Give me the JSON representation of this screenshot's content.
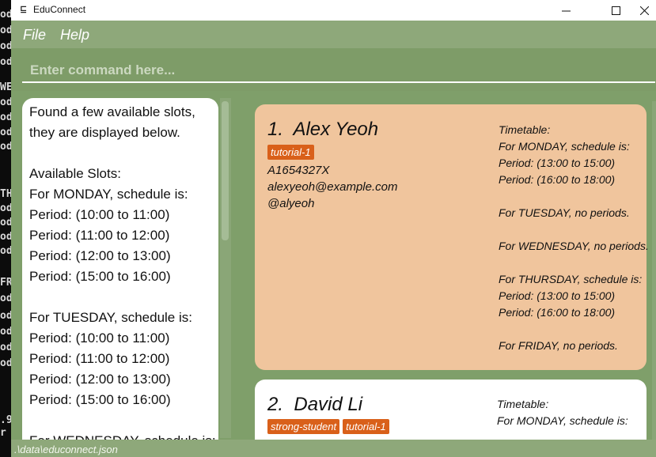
{
  "background_terminal": {
    "lines": [
      "od",
      "od",
      "od",
      "od",
      "WE",
      "od",
      "od",
      "od",
      "od",
      "TH",
      "od",
      "od",
      "od",
      "od",
      "FR",
      "od",
      "od",
      "od",
      "od",
      "od",
      "",
      ".9",
      "r"
    ]
  },
  "window": {
    "title": "EduConnect",
    "controls": {
      "minimize": "—",
      "maximize": "☐",
      "close": "✕"
    }
  },
  "menu": {
    "file": "File",
    "help": "Help"
  },
  "command": {
    "placeholder": "Enter command here...",
    "value": ""
  },
  "result": {
    "lines": [
      "Found a few available slots,",
      "they are displayed below.",
      "",
      "Available Slots:",
      "For MONDAY, schedule is:",
      "Period: (10:00 to 11:00)",
      "Period: (11:00 to 12:00)",
      "Period: (12:00 to 13:00)",
      "Period: (15:00 to 16:00)",
      "",
      "For TUESDAY, schedule is:",
      "Period: (10:00 to 11:00)",
      "Period: (11:00 to 12:00)",
      "Period: (12:00 to 13:00)",
      "Period: (15:00 to 16:00)",
      "",
      "For WEDNESDAY, schedule is:"
    ]
  },
  "persons": [
    {
      "index": "1.",
      "name": "Alex Yeoh",
      "tags": [
        "tutorial-1"
      ],
      "student_id": "A1654327X",
      "email": "alexyeoh@example.com",
      "telegram": "@alyeoh",
      "timetable": [
        "Timetable:",
        "For MONDAY, schedule is:",
        "Period: (13:00 to 15:00)",
        "Period: (16:00 to 18:00)",
        "",
        "For TUESDAY, no periods.",
        "",
        "For WEDNESDAY, no periods.",
        "",
        "For THURSDAY, schedule is:",
        "Period: (13:00 to 15:00)",
        "Period: (16:00 to 18:00)",
        "",
        "For FRIDAY, no periods."
      ]
    },
    {
      "index": "2.",
      "name": "David Li",
      "tags": [
        "strong-student",
        "tutorial-1"
      ],
      "timetable": [
        "Timetable:",
        "For MONDAY, schedule is:"
      ]
    }
  ],
  "status": {
    "file_path": ".\\data\\educonnect.json"
  },
  "colors": {
    "accent_tag": "#d9601a",
    "card_selected": "#f0c59d",
    "theme_green": "#7f9f6a"
  }
}
